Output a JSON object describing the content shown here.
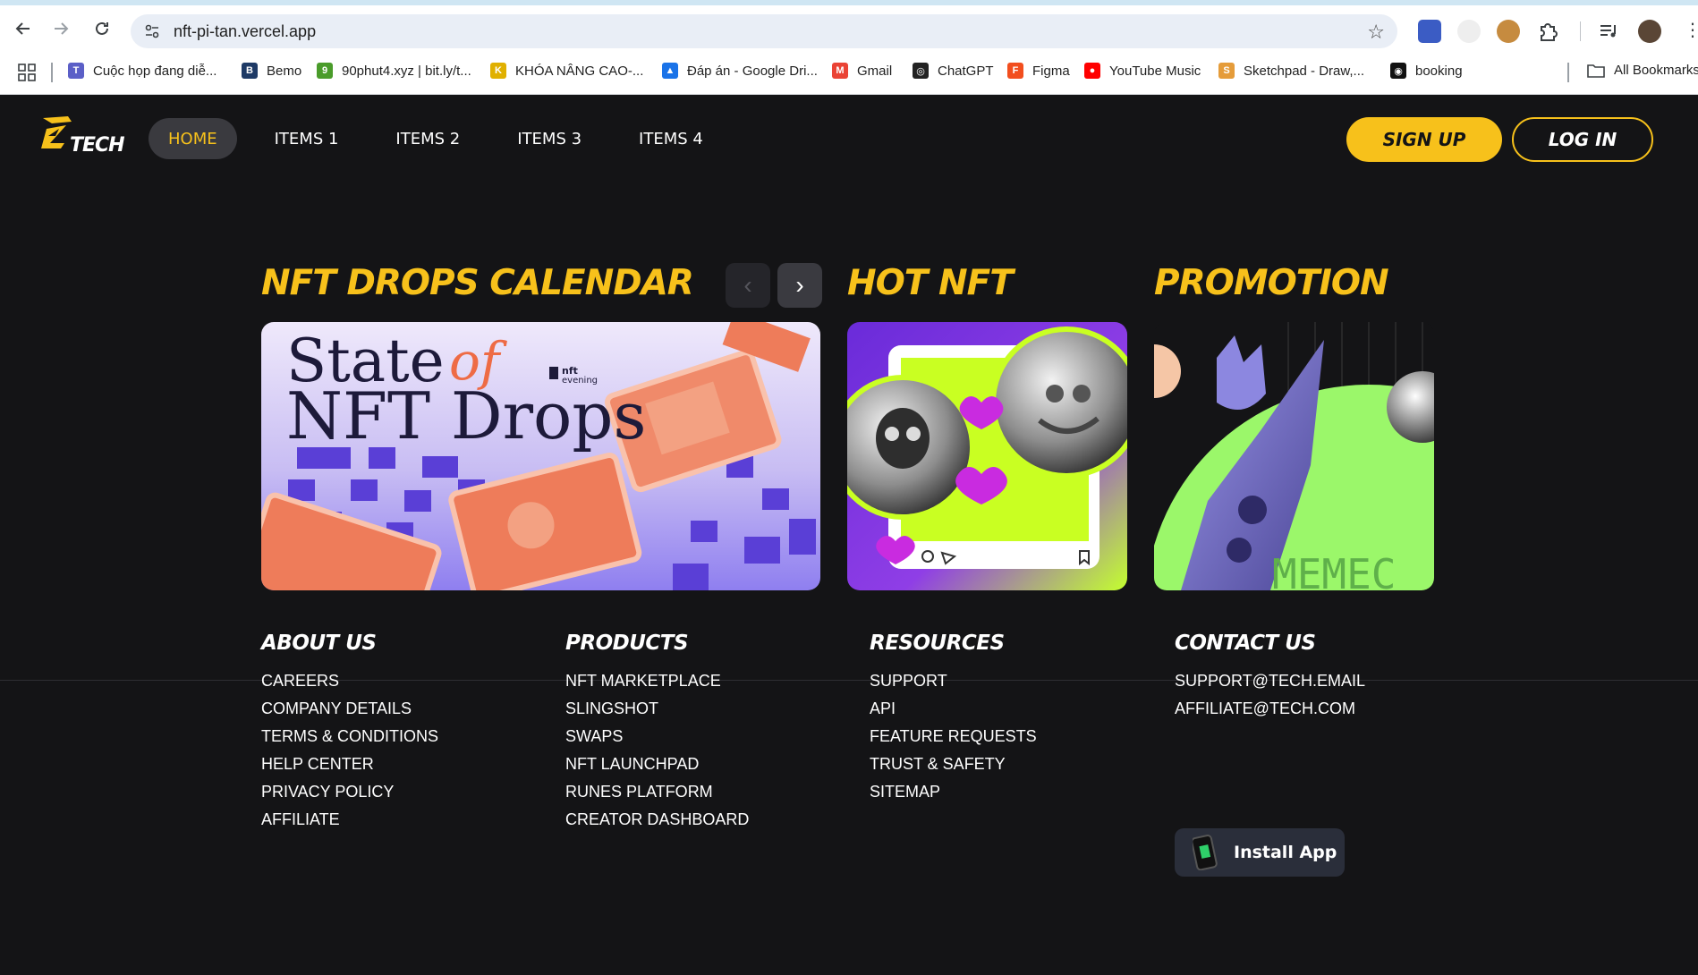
{
  "browser": {
    "url": "nft-pi-tan.vercel.app",
    "bookmarks": [
      {
        "label": "Cuộc họp đang diễ...",
        "icon": "teams-icon",
        "color": "#5b5fc7"
      },
      {
        "label": "Bemo",
        "icon": "bemo-icon",
        "color": "#1e3a66"
      },
      {
        "label": "90phut4.xyz | bit.ly/t...",
        "icon": "90phut-icon",
        "color": "#4a9c2a"
      },
      {
        "label": "KHÓA NÂNG CAO-...",
        "icon": "course-icon",
        "color": "#e0b000"
      },
      {
        "label": "Đáp án - Google Dri...",
        "icon": "google-drive-icon",
        "color": "#1a73e8"
      },
      {
        "label": "Gmail",
        "icon": "gmail-icon",
        "color": "#ea4335"
      },
      {
        "label": "ChatGPT",
        "icon": "chatgpt-icon",
        "color": "#222222"
      },
      {
        "label": "Figma",
        "icon": "figma-icon",
        "color": "#f24e1e"
      },
      {
        "label": "YouTube Music",
        "icon": "youtube-music-icon",
        "color": "#ff0000"
      },
      {
        "label": "Sketchpad - Draw,...",
        "icon": "sketchpad-icon",
        "color": "#e59c3a"
      },
      {
        "label": "booking",
        "icon": "github-icon",
        "color": "#111111"
      }
    ],
    "all_bookmarks": "All Bookmarks"
  },
  "header": {
    "logo_text": "TECH",
    "menu": [
      {
        "label": "HOME",
        "active": true
      },
      {
        "label": "ITEMS 1",
        "active": false
      },
      {
        "label": "ITEMS 2",
        "active": false
      },
      {
        "label": "ITEMS 3",
        "active": false
      },
      {
        "label": "ITEMS 4",
        "active": false
      }
    ],
    "signup_label": "SIGN UP",
    "login_label": "LOG IN"
  },
  "sections": {
    "drops": {
      "title": "NFT DROPS CALENDAR",
      "card_line1": "State",
      "card_line2": "NFT Drops",
      "card_of": "of",
      "card_brand_top": "nft",
      "card_brand_bottom": "evening"
    },
    "hot": {
      "title": "HOT NFT"
    },
    "promo": {
      "title": "PROMOTION",
      "card_text": "MEMEC"
    }
  },
  "footer": {
    "about": {
      "title": "ABOUT US",
      "links": [
        "CAREERS",
        "COMPANY DETAILS",
        "TERMS & CONDITIONS",
        "HELP CENTER",
        "PRIVACY POLICY",
        "AFFILIATE"
      ]
    },
    "products": {
      "title": "PRODUCTS",
      "links": [
        "NFT MARKETPLACE",
        "SLINGSHOT",
        "SWAPS",
        "NFT LAUNCHPAD",
        "RUNES PLATFORM",
        "CREATOR DASHBOARD"
      ]
    },
    "resources": {
      "title": "RESOURCES",
      "links": [
        "SUPPORT",
        "API",
        "FEATURE REQUESTS",
        "TRUST & SAFETY",
        "SITEMAP"
      ]
    },
    "contact": {
      "title": "CONTACT US",
      "links": [
        "SUPPORT@TECH.EMAIL",
        "AFFILIATE@TECH.COM"
      ],
      "install_label": "Install App"
    }
  },
  "colors": {
    "accent": "#f7c11b",
    "background": "#141416",
    "install_bg": "#2a2e3a"
  }
}
